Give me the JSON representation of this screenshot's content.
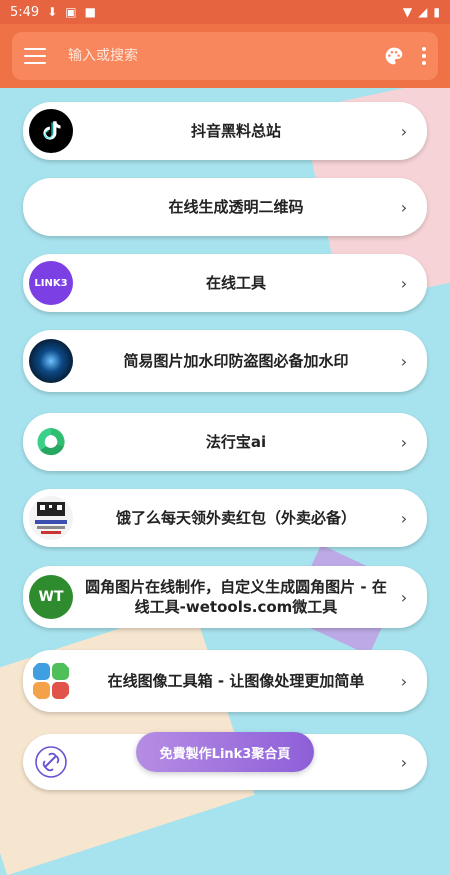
{
  "status_bar": {
    "time": "5:49"
  },
  "header": {
    "search_placeholder": "输入或搜索"
  },
  "items": [
    {
      "label": "抖音黑料总站",
      "logo": "tiktok-logo"
    },
    {
      "label": "在线生成透明二维码",
      "logo": "none"
    },
    {
      "label": "在线工具",
      "logo": "link3-logo",
      "logo_text": "LINK3"
    },
    {
      "label": "简易图片加水印防盗图必备加水印",
      "logo": "globe-logo"
    },
    {
      "label": "法行宝ai",
      "logo": "green-swirl-logo"
    },
    {
      "label": "饿了么每天领外卖红包（外卖必备）",
      "logo": "qr-thumbnail"
    },
    {
      "label": "圆角图片在线制作，自定义生成圆角图片 - 在线工具-wetools.com微工具",
      "logo": "wt-logo",
      "logo_text": "WT"
    },
    {
      "label": "在线图像工具箱 - 让图像处理更加简单",
      "logo": "grid-logo"
    },
    {
      "label": "",
      "logo": "link-logo"
    }
  ],
  "fab": {
    "label": "免費製作Link3聚合頁"
  },
  "colors": {
    "status_bar": "#e6643f",
    "header": "#ef7146",
    "search_bar": "#f8875d",
    "background": "#a7e3ee",
    "fab_gradient_start": "#b58de4",
    "fab_gradient_end": "#8d5fd8"
  }
}
